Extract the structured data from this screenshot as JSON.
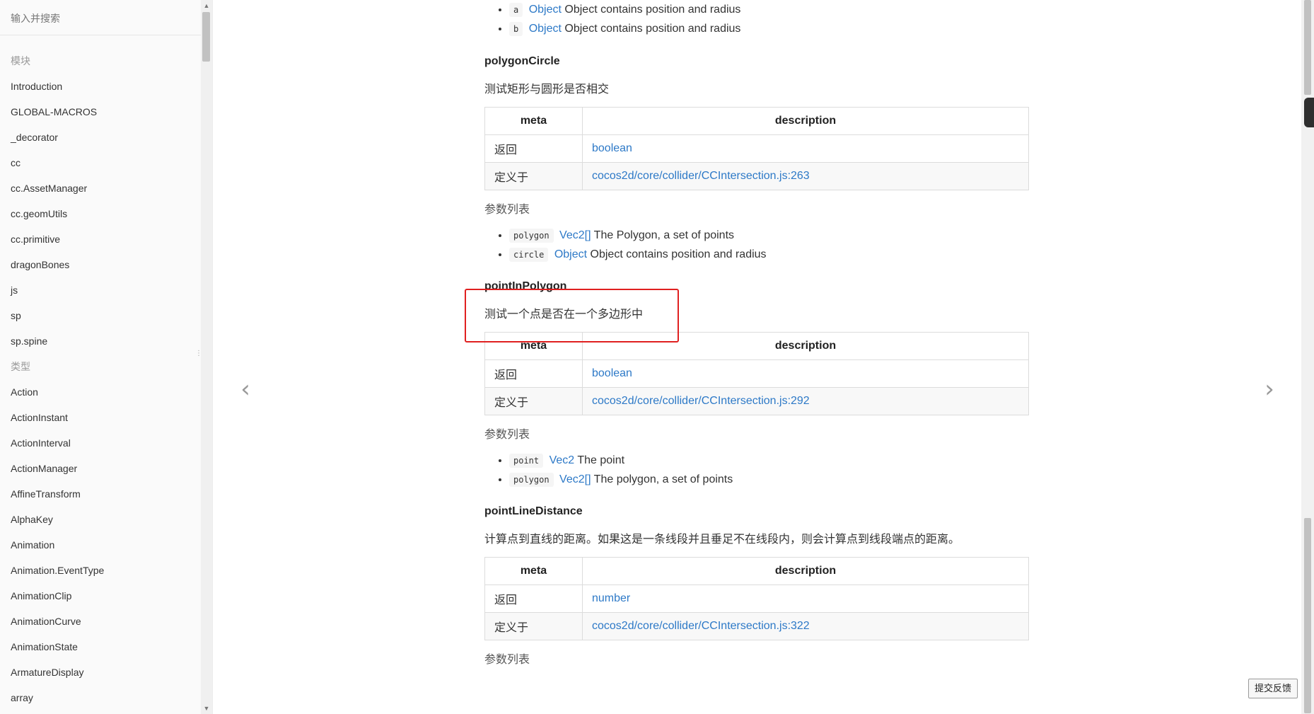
{
  "sidebar": {
    "search_placeholder": "输入并搜索",
    "modules_title": "模块",
    "modules": [
      "Introduction",
      "GLOBAL-MACROS",
      "_decorator",
      "cc",
      "cc.AssetManager",
      "cc.geomUtils",
      "cc.primitive",
      "dragonBones",
      "js",
      "sp",
      "sp.spine"
    ],
    "types_title": "类型",
    "types": [
      "Action",
      "ActionInstant",
      "ActionInterval",
      "ActionManager",
      "AffineTransform",
      "AlphaKey",
      "Animation",
      "Animation.EventType",
      "AnimationClip",
      "AnimationCurve",
      "AnimationState",
      "ArmatureDisplay",
      "array"
    ]
  },
  "content": {
    "top_params": [
      {
        "name": "a",
        "type": "Object",
        "desc": "Object contains position and radius"
      },
      {
        "name": "b",
        "type": "Object",
        "desc": "Object contains position and radius"
      }
    ],
    "polygonCircle": {
      "title": "polygonCircle",
      "desc": "测试矩形与圆形是否相交",
      "th_meta": "meta",
      "th_desc": "description",
      "row1_label": "返回",
      "row1_value": "boolean",
      "row2_label": "定义于",
      "row2_value": "cocos2d/core/collider/CCIntersection.js:263",
      "params_label": "参数列表",
      "params": [
        {
          "name": "polygon",
          "type": "Vec2[]",
          "desc": "The Polygon, a set of points"
        },
        {
          "name": "circle",
          "type": "Object",
          "desc": "Object contains position and radius"
        }
      ]
    },
    "pointInPolygon": {
      "title": "pointInPolygon",
      "desc": "测试一个点是否在一个多边形中",
      "th_meta": "meta",
      "th_desc": "description",
      "row1_label": "返回",
      "row1_value": "boolean",
      "row2_label": "定义于",
      "row2_value": "cocos2d/core/collider/CCIntersection.js:292",
      "params_label": "参数列表",
      "params": [
        {
          "name": "point",
          "type": "Vec2",
          "desc": "The point"
        },
        {
          "name": "polygon",
          "type": "Vec2[]",
          "desc": "The polygon, a set of points"
        }
      ]
    },
    "pointLineDistance": {
      "title": "pointLineDistance",
      "desc": "计算点到直线的距离。如果这是一条线段并且垂足不在线段内，则会计算点到线段端点的距离。",
      "th_meta": "meta",
      "th_desc": "description",
      "row1_label": "返回",
      "row1_value": "number",
      "row2_label": "定义于",
      "row2_value": "cocos2d/core/collider/CCIntersection.js:322",
      "params_label": "参数列表"
    }
  },
  "nav": {
    "prev_glyph": "‹",
    "next_glyph": "›"
  },
  "feedback_label": "提交反馈"
}
